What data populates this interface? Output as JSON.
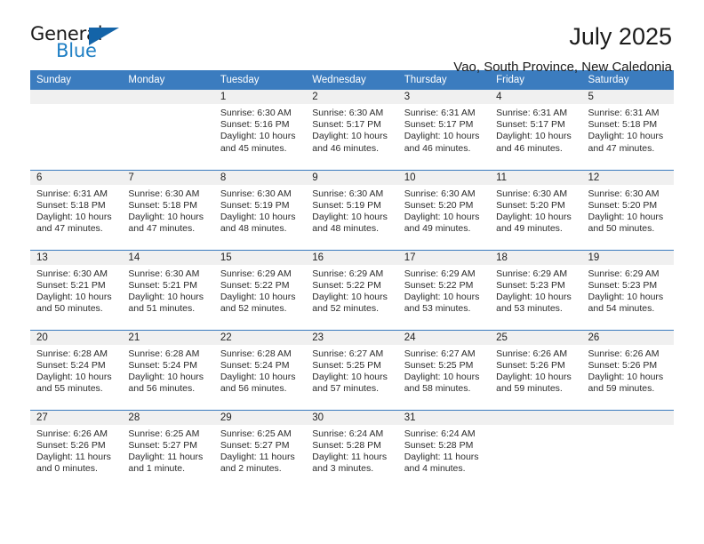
{
  "brand": {
    "name_top": "General",
    "name_bottom": "Blue",
    "triangle_color": "#1464a8",
    "blue": "#1f7fc4"
  },
  "header": {
    "title": "July 2025",
    "subtitle": "Vao, South Province, New Caledonia",
    "header_bg": "#3b7cbf",
    "daynum_bg": "#f0f0f0"
  },
  "weekday_headers": [
    "Sunday",
    "Monday",
    "Tuesday",
    "Wednesday",
    "Thursday",
    "Friday",
    "Saturday"
  ],
  "weeks": [
    [
      {
        "day": "",
        "blank": true
      },
      {
        "day": "",
        "blank": true
      },
      {
        "day": "1",
        "sunrise": "Sunrise: 6:30 AM",
        "sunset": "Sunset: 5:16 PM",
        "daylight1": "Daylight: 10 hours",
        "daylight2": "and 45 minutes."
      },
      {
        "day": "2",
        "sunrise": "Sunrise: 6:30 AM",
        "sunset": "Sunset: 5:17 PM",
        "daylight1": "Daylight: 10 hours",
        "daylight2": "and 46 minutes."
      },
      {
        "day": "3",
        "sunrise": "Sunrise: 6:31 AM",
        "sunset": "Sunset: 5:17 PM",
        "daylight1": "Daylight: 10 hours",
        "daylight2": "and 46 minutes."
      },
      {
        "day": "4",
        "sunrise": "Sunrise: 6:31 AM",
        "sunset": "Sunset: 5:17 PM",
        "daylight1": "Daylight: 10 hours",
        "daylight2": "and 46 minutes."
      },
      {
        "day": "5",
        "sunrise": "Sunrise: 6:31 AM",
        "sunset": "Sunset: 5:18 PM",
        "daylight1": "Daylight: 10 hours",
        "daylight2": "and 47 minutes."
      }
    ],
    [
      {
        "day": "6",
        "sunrise": "Sunrise: 6:31 AM",
        "sunset": "Sunset: 5:18 PM",
        "daylight1": "Daylight: 10 hours",
        "daylight2": "and 47 minutes."
      },
      {
        "day": "7",
        "sunrise": "Sunrise: 6:30 AM",
        "sunset": "Sunset: 5:18 PM",
        "daylight1": "Daylight: 10 hours",
        "daylight2": "and 47 minutes."
      },
      {
        "day": "8",
        "sunrise": "Sunrise: 6:30 AM",
        "sunset": "Sunset: 5:19 PM",
        "daylight1": "Daylight: 10 hours",
        "daylight2": "and 48 minutes."
      },
      {
        "day": "9",
        "sunrise": "Sunrise: 6:30 AM",
        "sunset": "Sunset: 5:19 PM",
        "daylight1": "Daylight: 10 hours",
        "daylight2": "and 48 minutes."
      },
      {
        "day": "10",
        "sunrise": "Sunrise: 6:30 AM",
        "sunset": "Sunset: 5:20 PM",
        "daylight1": "Daylight: 10 hours",
        "daylight2": "and 49 minutes."
      },
      {
        "day": "11",
        "sunrise": "Sunrise: 6:30 AM",
        "sunset": "Sunset: 5:20 PM",
        "daylight1": "Daylight: 10 hours",
        "daylight2": "and 49 minutes."
      },
      {
        "day": "12",
        "sunrise": "Sunrise: 6:30 AM",
        "sunset": "Sunset: 5:20 PM",
        "daylight1": "Daylight: 10 hours",
        "daylight2": "and 50 minutes."
      }
    ],
    [
      {
        "day": "13",
        "sunrise": "Sunrise: 6:30 AM",
        "sunset": "Sunset: 5:21 PM",
        "daylight1": "Daylight: 10 hours",
        "daylight2": "and 50 minutes."
      },
      {
        "day": "14",
        "sunrise": "Sunrise: 6:30 AM",
        "sunset": "Sunset: 5:21 PM",
        "daylight1": "Daylight: 10 hours",
        "daylight2": "and 51 minutes."
      },
      {
        "day": "15",
        "sunrise": "Sunrise: 6:29 AM",
        "sunset": "Sunset: 5:22 PM",
        "daylight1": "Daylight: 10 hours",
        "daylight2": "and 52 minutes."
      },
      {
        "day": "16",
        "sunrise": "Sunrise: 6:29 AM",
        "sunset": "Sunset: 5:22 PM",
        "daylight1": "Daylight: 10 hours",
        "daylight2": "and 52 minutes."
      },
      {
        "day": "17",
        "sunrise": "Sunrise: 6:29 AM",
        "sunset": "Sunset: 5:22 PM",
        "daylight1": "Daylight: 10 hours",
        "daylight2": "and 53 minutes."
      },
      {
        "day": "18",
        "sunrise": "Sunrise: 6:29 AM",
        "sunset": "Sunset: 5:23 PM",
        "daylight1": "Daylight: 10 hours",
        "daylight2": "and 53 minutes."
      },
      {
        "day": "19",
        "sunrise": "Sunrise: 6:29 AM",
        "sunset": "Sunset: 5:23 PM",
        "daylight1": "Daylight: 10 hours",
        "daylight2": "and 54 minutes."
      }
    ],
    [
      {
        "day": "20",
        "sunrise": "Sunrise: 6:28 AM",
        "sunset": "Sunset: 5:24 PM",
        "daylight1": "Daylight: 10 hours",
        "daylight2": "and 55 minutes."
      },
      {
        "day": "21",
        "sunrise": "Sunrise: 6:28 AM",
        "sunset": "Sunset: 5:24 PM",
        "daylight1": "Daylight: 10 hours",
        "daylight2": "and 56 minutes."
      },
      {
        "day": "22",
        "sunrise": "Sunrise: 6:28 AM",
        "sunset": "Sunset: 5:24 PM",
        "daylight1": "Daylight: 10 hours",
        "daylight2": "and 56 minutes."
      },
      {
        "day": "23",
        "sunrise": "Sunrise: 6:27 AM",
        "sunset": "Sunset: 5:25 PM",
        "daylight1": "Daylight: 10 hours",
        "daylight2": "and 57 minutes."
      },
      {
        "day": "24",
        "sunrise": "Sunrise: 6:27 AM",
        "sunset": "Sunset: 5:25 PM",
        "daylight1": "Daylight: 10 hours",
        "daylight2": "and 58 minutes."
      },
      {
        "day": "25",
        "sunrise": "Sunrise: 6:26 AM",
        "sunset": "Sunset: 5:26 PM",
        "daylight1": "Daylight: 10 hours",
        "daylight2": "and 59 minutes."
      },
      {
        "day": "26",
        "sunrise": "Sunrise: 6:26 AM",
        "sunset": "Sunset: 5:26 PM",
        "daylight1": "Daylight: 10 hours",
        "daylight2": "and 59 minutes."
      }
    ],
    [
      {
        "day": "27",
        "sunrise": "Sunrise: 6:26 AM",
        "sunset": "Sunset: 5:26 PM",
        "daylight1": "Daylight: 11 hours",
        "daylight2": "and 0 minutes."
      },
      {
        "day": "28",
        "sunrise": "Sunrise: 6:25 AM",
        "sunset": "Sunset: 5:27 PM",
        "daylight1": "Daylight: 11 hours",
        "daylight2": "and 1 minute."
      },
      {
        "day": "29",
        "sunrise": "Sunrise: 6:25 AM",
        "sunset": "Sunset: 5:27 PM",
        "daylight1": "Daylight: 11 hours",
        "daylight2": "and 2 minutes."
      },
      {
        "day": "30",
        "sunrise": "Sunrise: 6:24 AM",
        "sunset": "Sunset: 5:28 PM",
        "daylight1": "Daylight: 11 hours",
        "daylight2": "and 3 minutes."
      },
      {
        "day": "31",
        "sunrise": "Sunrise: 6:24 AM",
        "sunset": "Sunset: 5:28 PM",
        "daylight1": "Daylight: 11 hours",
        "daylight2": "and 4 minutes."
      },
      {
        "day": "",
        "blank": true
      },
      {
        "day": "",
        "blank": true
      }
    ]
  ]
}
